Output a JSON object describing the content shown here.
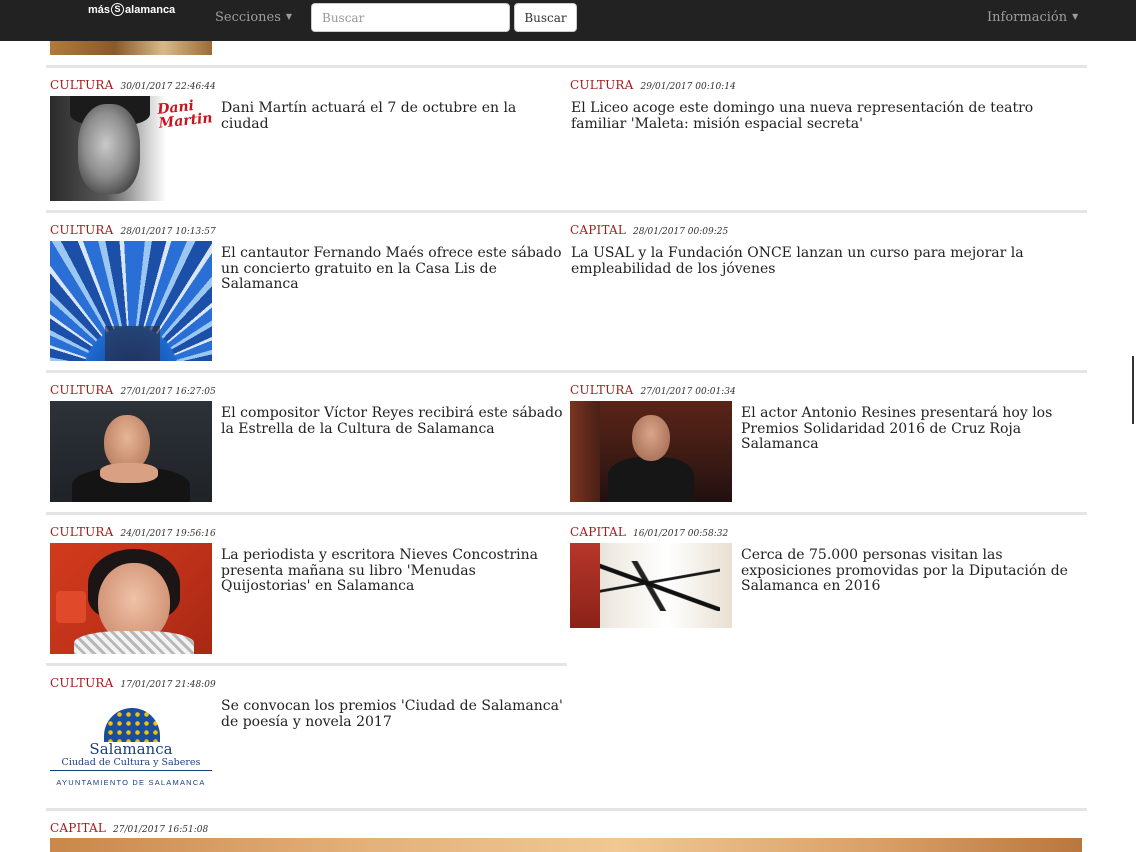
{
  "navbar": {
    "logo_prefix": "más",
    "logo_mark": "S",
    "logo_suffix": "alamanca",
    "sections_label": "Secciones",
    "search_placeholder": "Buscar",
    "search_button": "Buscar",
    "info_label": "Información"
  },
  "articles": [
    {
      "category": "CULTURA",
      "date": "30/01/2017 22:46:44",
      "title": "Dani Martín actuará el 7 de octubre en la ciudad",
      "thumb_text": "Dani Martin"
    },
    {
      "category": "CULTURA",
      "date": "29/01/2017 00:10:14",
      "title": "El Liceo acoge este domingo una nueva representación de teatro familiar 'Maleta: misión espacial secreta'"
    },
    {
      "category": "CULTURA",
      "date": "28/01/2017 10:13:57",
      "title": "El cantautor Fernando Maés ofrece este sábado un concierto gratuito en la Casa Lis de Salamanca"
    },
    {
      "category": "CAPITAL",
      "date": "28/01/2017 00:09:25",
      "title": "La USAL y la Fundación ONCE lanzan un curso para mejorar la empleabilidad de los jóvenes"
    },
    {
      "category": "CULTURA",
      "date": "27/01/2017 16:27:05",
      "title": "El compositor Víctor Reyes recibirá este sábado la Estrella de la Cultura de Salamanca"
    },
    {
      "category": "CULTURA",
      "date": "27/01/2017 00:01:34",
      "title": "El actor Antonio Resines presentará hoy los Premios Solidaridad 2016 de Cruz Roja Salamanca"
    },
    {
      "category": "CULTURA",
      "date": "24/01/2017 19:56:16",
      "title": "La periodista y escritora Nieves Concostrina presenta mañana su libro 'Menudas Quijostorias' en Salamanca"
    },
    {
      "category": "CAPITAL",
      "date": "16/01/2017 00:58:32",
      "title": "Cerca de 75.000 personas visitan las exposiciones promovidas por la Diputación de Salamanca en 2016"
    },
    {
      "category": "CULTURA",
      "date": "17/01/2017 21:48:09",
      "title": "Se convocan los premios 'Ciudad de Salamanca' de poesía y novela 2017",
      "thumb_name": "Salamanca",
      "thumb_sub": "Ciudad de Cultura y Saberes",
      "thumb_footer": "AYUNTAMIENTO DE SALAMANCA"
    },
    {
      "category": "CAPITAL",
      "date": "27/01/2017 16:51:08"
    }
  ],
  "colors": {
    "category": "#a51c1c",
    "navbar": "#222222",
    "divider": "#e5e5e5"
  }
}
